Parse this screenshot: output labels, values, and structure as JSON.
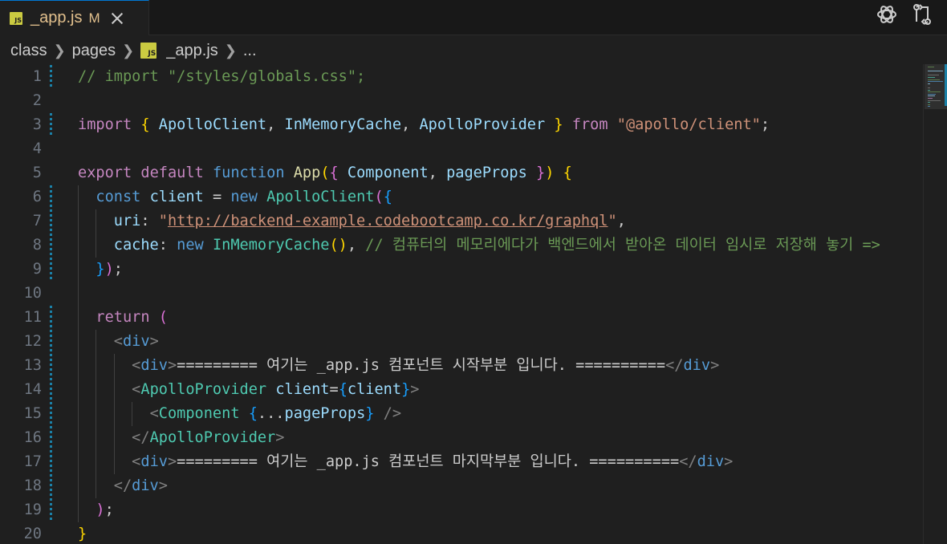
{
  "tab": {
    "filename": "_app.js",
    "status": "M",
    "icon": "js-file-icon"
  },
  "toolbar": {
    "icons": [
      "chatgpt-icon",
      "compare-changes-icon"
    ]
  },
  "breadcrumb": {
    "items": [
      "class",
      "pages",
      "_app.js",
      "..."
    ]
  },
  "colors": {
    "background": "#1f1f1f",
    "modified_tab": "#e2c08d",
    "gutter_modified": "#1b81a8"
  },
  "lines": [
    {
      "n": "1",
      "c": [
        [
          "cm",
          "// import \"/styles/globals.css\";"
        ]
      ]
    },
    {
      "n": "2",
      "c": []
    },
    {
      "n": "3",
      "c": [
        [
          "ctl",
          "import"
        ],
        [
          "p",
          " "
        ],
        [
          "br1",
          "{"
        ],
        [
          "p",
          " "
        ],
        [
          "var",
          "ApolloClient"
        ],
        [
          "p",
          ", "
        ],
        [
          "var",
          "InMemoryCache"
        ],
        [
          "p",
          ", "
        ],
        [
          "var",
          "ApolloProvider"
        ],
        [
          "p",
          " "
        ],
        [
          "br1",
          "}"
        ],
        [
          "p",
          " "
        ],
        [
          "ctl",
          "from"
        ],
        [
          "p",
          " "
        ],
        [
          "str",
          "\"@apollo/client\""
        ],
        [
          "p",
          ";"
        ]
      ]
    },
    {
      "n": "4",
      "c": []
    },
    {
      "n": "5",
      "c": [
        [
          "ctl",
          "export"
        ],
        [
          "p",
          " "
        ],
        [
          "ctl",
          "default"
        ],
        [
          "p",
          " "
        ],
        [
          "kw",
          "function"
        ],
        [
          "p",
          " "
        ],
        [
          "fn",
          "App"
        ],
        [
          "br1",
          "("
        ],
        [
          "br2",
          "{"
        ],
        [
          "p",
          " "
        ],
        [
          "var",
          "Component"
        ],
        [
          "p",
          ", "
        ],
        [
          "var",
          "pageProps"
        ],
        [
          "p",
          " "
        ],
        [
          "br2",
          "}"
        ],
        [
          "br1",
          ")"
        ],
        [
          "p",
          " "
        ],
        [
          "br1",
          "{"
        ]
      ]
    },
    {
      "n": "6",
      "c": [
        [
          "p",
          "  "
        ],
        [
          "kw",
          "const"
        ],
        [
          "p",
          " "
        ],
        [
          "var",
          "client"
        ],
        [
          "p",
          " = "
        ],
        [
          "kw",
          "new"
        ],
        [
          "p",
          " "
        ],
        [
          "cls",
          "ApolloClient"
        ],
        [
          "br2",
          "("
        ],
        [
          "br3",
          "{"
        ]
      ]
    },
    {
      "n": "7",
      "c": [
        [
          "p",
          "    "
        ],
        [
          "var",
          "uri"
        ],
        [
          "p",
          ": "
        ],
        [
          "str",
          "\""
        ],
        [
          "url",
          "http://backend-example.codebootcamp.co.kr/graphql"
        ],
        [
          "str",
          "\""
        ],
        [
          "p",
          ","
        ]
      ]
    },
    {
      "n": "8",
      "c": [
        [
          "p",
          "    "
        ],
        [
          "var",
          "cache"
        ],
        [
          "p",
          ": "
        ],
        [
          "kw",
          "new"
        ],
        [
          "p",
          " "
        ],
        [
          "cls",
          "InMemoryCache"
        ],
        [
          "br1",
          "()"
        ],
        [
          "p",
          ", "
        ],
        [
          "cm",
          "// 컴퓨터의 메모리에다가 백엔드에서 받아온 데이터 임시로 저장해 놓기 =>"
        ]
      ]
    },
    {
      "n": "9",
      "c": [
        [
          "p",
          "  "
        ],
        [
          "br3",
          "}"
        ],
        [
          "br2",
          ")"
        ],
        [
          "p",
          ";"
        ]
      ]
    },
    {
      "n": "10",
      "c": []
    },
    {
      "n": "11",
      "c": [
        [
          "p",
          "  "
        ],
        [
          "ctl",
          "return"
        ],
        [
          "p",
          " "
        ],
        [
          "br2",
          "("
        ]
      ]
    },
    {
      "n": "12",
      "c": [
        [
          "p",
          "    "
        ],
        [
          "tag",
          "<"
        ],
        [
          "tagn",
          "div"
        ],
        [
          "tag",
          ">"
        ]
      ]
    },
    {
      "n": "13",
      "c": [
        [
          "p",
          "      "
        ],
        [
          "tag",
          "<"
        ],
        [
          "tagn",
          "div"
        ],
        [
          "tag",
          ">"
        ],
        [
          "p",
          "========= 여기는 _app.js 컴포넌트 시작부분 입니다. =========="
        ],
        [
          "tag",
          "</"
        ],
        [
          "tagn",
          "div"
        ],
        [
          "tag",
          ">"
        ]
      ]
    },
    {
      "n": "14",
      "c": [
        [
          "p",
          "      "
        ],
        [
          "tag",
          "<"
        ],
        [
          "comp",
          "ApolloProvider"
        ],
        [
          "p",
          " "
        ],
        [
          "var",
          "client"
        ],
        [
          "p",
          "="
        ],
        [
          "br3",
          "{"
        ],
        [
          "var",
          "client"
        ],
        [
          "br3",
          "}"
        ],
        [
          "tag",
          ">"
        ]
      ]
    },
    {
      "n": "15",
      "c": [
        [
          "p",
          "        "
        ],
        [
          "tag",
          "<"
        ],
        [
          "comp",
          "Component"
        ],
        [
          "p",
          " "
        ],
        [
          "br3",
          "{"
        ],
        [
          "p",
          "..."
        ],
        [
          "var",
          "pageProps"
        ],
        [
          "br3",
          "}"
        ],
        [
          "p",
          " "
        ],
        [
          "tag",
          "/>"
        ]
      ]
    },
    {
      "n": "16",
      "c": [
        [
          "p",
          "      "
        ],
        [
          "tag",
          "</"
        ],
        [
          "comp",
          "ApolloProvider"
        ],
        [
          "tag",
          ">"
        ]
      ]
    },
    {
      "n": "17",
      "c": [
        [
          "p",
          "      "
        ],
        [
          "tag",
          "<"
        ],
        [
          "tagn",
          "div"
        ],
        [
          "tag",
          ">"
        ],
        [
          "p",
          "========= 여기는 _app.js 컴포넌트 마지막부분 입니다. =========="
        ],
        [
          "tag",
          "</"
        ],
        [
          "tagn",
          "div"
        ],
        [
          "tag",
          ">"
        ]
      ]
    },
    {
      "n": "18",
      "c": [
        [
          "p",
          "    "
        ],
        [
          "tag",
          "</"
        ],
        [
          "tagn",
          "div"
        ],
        [
          "tag",
          ">"
        ]
      ]
    },
    {
      "n": "19",
      "c": [
        [
          "p",
          "  "
        ],
        [
          "br2",
          ")"
        ],
        [
          "p",
          ";"
        ]
      ]
    },
    {
      "n": "20",
      "c": [
        [
          "br1",
          "}"
        ]
      ]
    }
  ]
}
